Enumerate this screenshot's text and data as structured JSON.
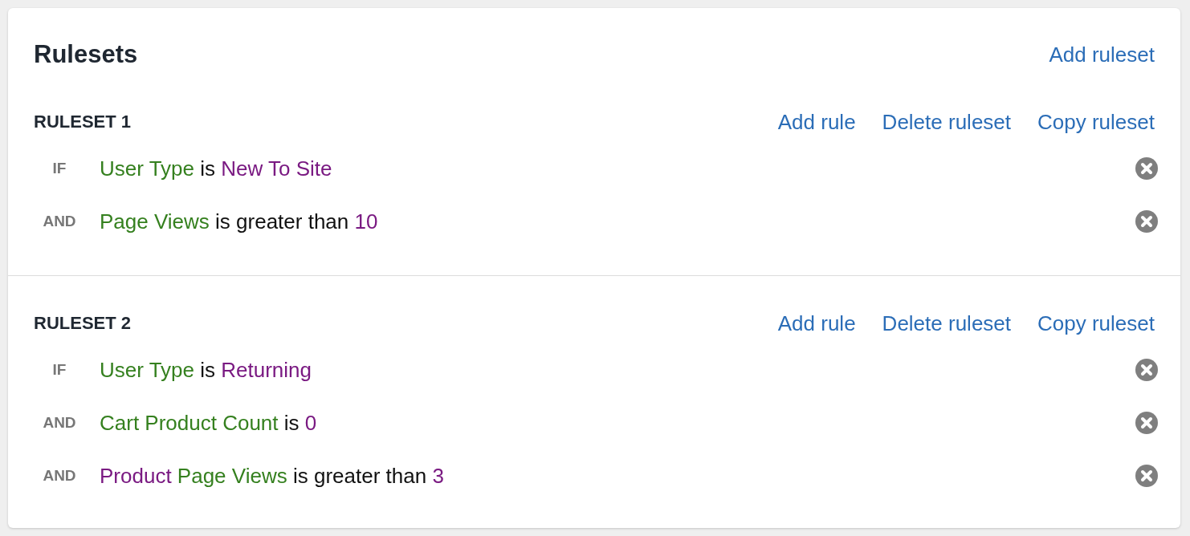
{
  "title": "Rulesets",
  "add_ruleset": "Add ruleset",
  "rulesets": [
    {
      "heading": "RULESET 1",
      "actions": [
        "Add rule",
        "Delete ruleset",
        "Copy ruleset"
      ],
      "rules": [
        {
          "connector": "IF",
          "parts": [
            {
              "text": "User Type",
              "color": "#35801f"
            },
            {
              "text": "is",
              "color": "#111111"
            },
            {
              "text": "New To Site",
              "color": "#7a1a82"
            }
          ]
        },
        {
          "connector": "AND",
          "parts": [
            {
              "text": "Page Views",
              "color": "#35801f"
            },
            {
              "text": "is greater than",
              "color": "#111111"
            },
            {
              "text": "10",
              "color": "#7a1a82"
            }
          ]
        }
      ]
    },
    {
      "heading": "RULESET 2",
      "actions": [
        "Add rule",
        "Delete ruleset",
        "Copy ruleset"
      ],
      "rules": [
        {
          "connector": "IF",
          "parts": [
            {
              "text": "User Type",
              "color": "#35801f"
            },
            {
              "text": "is",
              "color": "#111111"
            },
            {
              "text": "Returning",
              "color": "#7a1a82"
            }
          ]
        },
        {
          "connector": "AND",
          "parts": [
            {
              "text": "Cart Product Count",
              "color": "#35801f"
            },
            {
              "text": "is",
              "color": "#111111"
            },
            {
              "text": "0",
              "color": "#7a1a82"
            }
          ]
        },
        {
          "connector": "AND",
          "parts": [
            {
              "text": "Product",
              "color": "#7a1a82"
            },
            {
              "text": "Page Views",
              "color": "#35801f"
            },
            {
              "text": "is greater than",
              "color": "#111111"
            },
            {
              "text": "3",
              "color": "#7a1a82"
            }
          ]
        }
      ]
    }
  ]
}
